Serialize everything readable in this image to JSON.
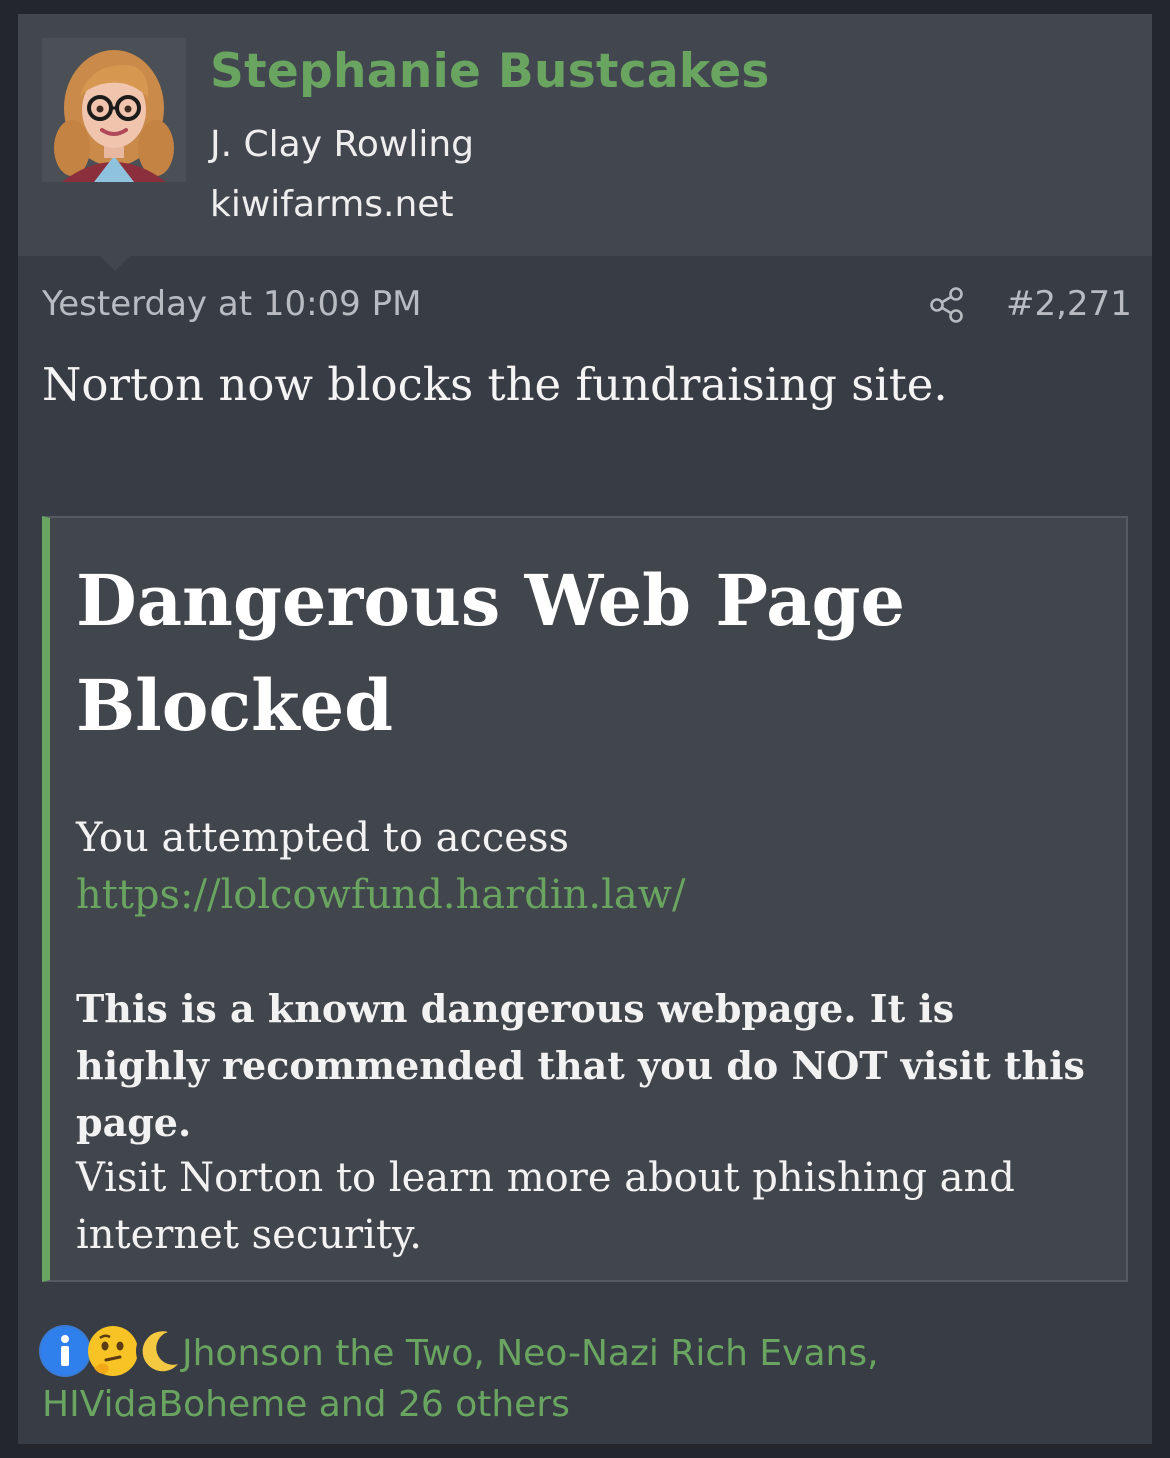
{
  "author": {
    "username": "Stephanie Bustcakes",
    "user_title": "J. Clay Rowling",
    "user_site": "kiwifarms.net",
    "avatar_icon": "cartoon-woman-avatar-icon"
  },
  "meta": {
    "timestamp": "Yesterday at 10:09 PM",
    "post_number": "#2,271",
    "share_icon": "share-icon"
  },
  "post": {
    "text": "Norton now blocks the fundraising site."
  },
  "quote": {
    "title": "Dangerous Web Page Blocked",
    "access_text": "You attempted to access",
    "url": "https://lolcowfund.hardin.law/",
    "warning": "This is a known dangerous webpage. It is highly recommended that you do NOT visit this page.",
    "info": "Visit Norton to learn more about phishing and internet security."
  },
  "reactions": {
    "icons": [
      "informative-icon",
      "thinking-icon",
      "moon-icon"
    ],
    "users_text": "Jhonson the Two, Neo-Nazi Rich Evans, HIVidaBoheme and 26 others"
  },
  "colors": {
    "accent": "#69a560",
    "page_bg": "#23262c",
    "post_bg": "#383c44",
    "header_bg": "#42464e",
    "quote_bg": "#41454c"
  }
}
